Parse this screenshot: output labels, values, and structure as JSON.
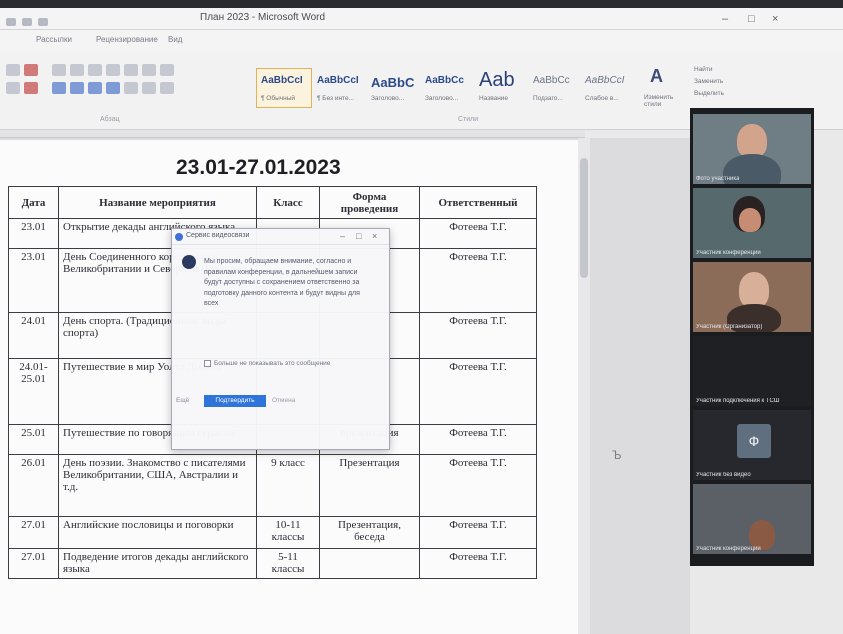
{
  "window": {
    "title": "План 2023 - Microsoft Word",
    "controls": {
      "minimize": "–",
      "maximize": "□",
      "close": "×"
    }
  },
  "menu": [
    "Рассылки",
    "Рецензирование",
    "Вид"
  ],
  "ribbon": {
    "group_paragraph": "Абзац",
    "group_styles": "Стили",
    "styles": [
      {
        "sample": "AaBbCcI",
        "name": "¶ Обычный"
      },
      {
        "sample": "AaBbCcI",
        "name": "¶ Без инте..."
      },
      {
        "sample": "AaBbC",
        "name": "Заголово..."
      },
      {
        "sample": "AaBbCc",
        "name": "Заголово..."
      },
      {
        "sample": "Aab",
        "name": "Название"
      },
      {
        "sample": "AaBbCc",
        "name": "Подзаго..."
      },
      {
        "sample": "AaBbCcI",
        "name": "Слабое в..."
      }
    ],
    "change_styles": "Изменить стили",
    "find": "Найти",
    "replace": "Заменить",
    "select": "Выделить"
  },
  "document": {
    "date_range": "23.01-27.01.2023",
    "headers": [
      "Дата",
      "Название мероприятия",
      "Класс",
      "Форма проведения",
      "Ответственный"
    ],
    "rows": [
      {
        "date": "23.01",
        "name": "Открытие декады английского языка",
        "class": "",
        "form": "",
        "resp": "Фотеева Т.Г."
      },
      {
        "date": "23.01",
        "name": "День Соединенного королевства Великобритании и Северной Ирландии",
        "class": "",
        "form": "",
        "resp": "Фотеева Т.Г."
      },
      {
        "date": "24.01",
        "name": "День спорта. (Традиционные виды спорта)",
        "class": "",
        "form": "",
        "resp": "Фотеева Т.Г."
      },
      {
        "date": "24.01-25.01",
        "name": "Путешествие в мир Уолта Диснея",
        "class": "",
        "form": "",
        "resp": "Фотеева Т.Г."
      },
      {
        "date": "25.01",
        "name": "Путешествие по говорящим странам",
        "class": "",
        "form": "презентация",
        "resp": "Фотеева Т.Г."
      },
      {
        "date": "26.01",
        "name": "День поэзии. Знакомство с писателями Великобритании, США, Австралии и т.д.",
        "class": "9 класс",
        "form": "Презентация",
        "resp": "Фотеева Т.Г."
      },
      {
        "date": "27.01",
        "name": "Английские пословицы и поговорки",
        "class": "10-11 классы",
        "form": "Презентация, беседа",
        "resp": "Фотеева Т.Г."
      },
      {
        "date": "27.01",
        "name": "Подведение итогов декады английского языка",
        "class": "5-11 классы",
        "form": "",
        "resp": "Фотеева Т.Г."
      }
    ]
  },
  "dialog": {
    "title": "Сервис видеосвязи",
    "message": "Мы просим, обращаем внимание, согласно и правилам конференции, в дальнейшем записи будут доступны с сохранением ответственно за подготовку данного контента и будут видны для всех",
    "checkbox": "Больше не показывать это сообщение",
    "primary": "Подтвердить",
    "secondary": "Отмена",
    "side": "Ещё"
  },
  "participants": [
    {
      "label": "Фото участника",
      "initial": ""
    },
    {
      "label": "Участник конференции",
      "initial": ""
    },
    {
      "label": "Участник (Организатор)",
      "initial": ""
    },
    {
      "label": "Участник подключения к ТСШ",
      "initial": ""
    },
    {
      "label": "Участник без видео",
      "initial": "Ф"
    },
    {
      "label": "Участник конференции",
      "initial": ""
    }
  ],
  "colors": {
    "accent": "#2f74d8",
    "page": "#fbfbfb",
    "panel": "#1b1c20"
  }
}
